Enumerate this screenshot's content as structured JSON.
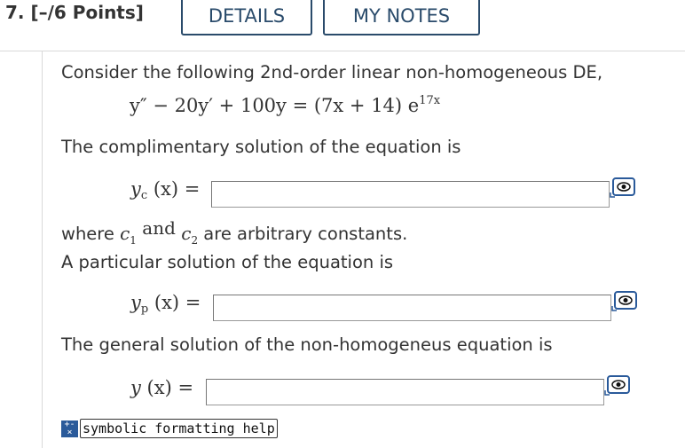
{
  "header": {
    "question_number": "7.",
    "points": "[–/6 Points]",
    "details_label": "DETAILS",
    "notes_label": "MY NOTES"
  },
  "question": {
    "intro": "Consider the following 2nd-order linear non-homogeneous DE,",
    "equation": {
      "lhs_part1": "y″ − 20y′ + 100y = (7x + 14) e",
      "exponent": "17x"
    },
    "complementary_prompt": "The complimentary solution of the equation is",
    "complementary_label": {
      "var": "y",
      "sub": "c",
      "rest": " (x) ="
    },
    "constants_where": "where",
    "constants_c1": "c",
    "constants_c1_sub": "1",
    "constants_and": " and ",
    "constants_c2": "c",
    "constants_c2_sub": "2",
    "constants_rest": " are arbitrary constants.",
    "particular_prompt": "A particular solution of the equation is",
    "particular_label": {
      "var": "y",
      "sub": "p",
      "rest": " (x) ="
    },
    "general_prompt": "The general solution of the non-homogeneus equation is",
    "general_label": {
      "var": "y",
      "rest": " (x) ="
    }
  },
  "inputs": {
    "complementary_value": "",
    "particular_value": "",
    "general_value": ""
  },
  "help": {
    "icon_name": "symbolic-help-icon",
    "label": "symbolic formatting help"
  },
  "icons": {
    "preview": "eye-preview-icon"
  },
  "colors": {
    "accent": "#2a4b6b",
    "help_icon_bg": "#2a5a9a",
    "text": "#333333"
  }
}
